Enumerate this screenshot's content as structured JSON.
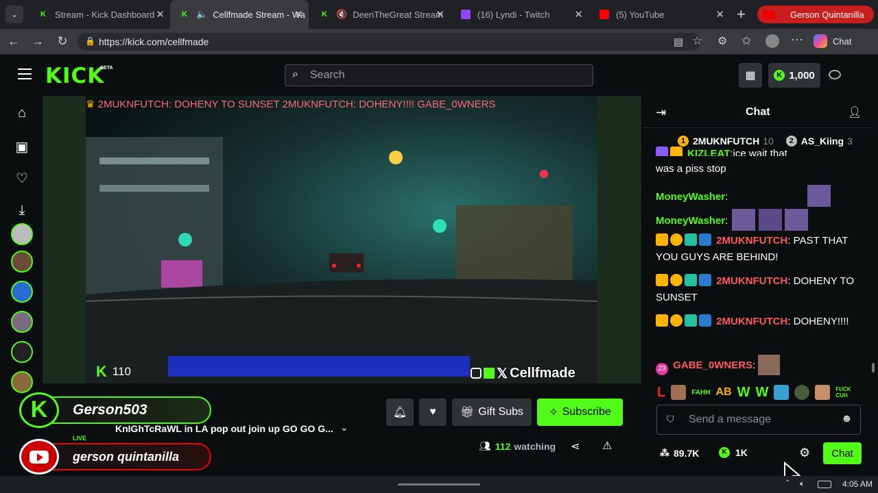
{
  "browser": {
    "tabs": [
      {
        "title": "Stream - Kick Dashboard",
        "favicon_color": "#53fc18"
      },
      {
        "title": "Cellfmade Stream - Wa",
        "favicon_color": "#53fc18"
      },
      {
        "title": "DeenTheGreat Stream",
        "favicon_color": "#53fc18"
      },
      {
        "title": "(16) Lyndi - Twitch",
        "favicon_color": "#9146ff"
      },
      {
        "title": "(5) YouTube",
        "favicon_color": "#ff0000"
      }
    ],
    "profile_name": "Gerson Quintanilla",
    "url": "https://kick.com/cellfmade",
    "copilot_label": "Chat"
  },
  "header": {
    "logo_text": "KICK",
    "beta_label": "BETA",
    "search_placeholder": "Search",
    "balance": "1,000"
  },
  "video": {
    "ticker": "2MUKNFUTCH: DOHENY TO SUNSET   2MUKNFUTCH: DOHENY!!!!   GABE_0WNERS",
    "viewer_count": "110",
    "watermark": "Cellfmade"
  },
  "overlay": {
    "kick_name": "Gerson503",
    "youtube_name": "gerson quintanilla",
    "live_label": "LIVE"
  },
  "stream_info": {
    "title": "KnIGhTcRaWL in LA pop out join up GO GO G...",
    "gift_subs": "Gift Subs",
    "subscribe": "Subscribe",
    "watching_count": "112",
    "watching_label": "watching"
  },
  "chat": {
    "title": "Chat",
    "leaderboard": [
      {
        "name": "2MUKNFUTCH",
        "count": "10",
        "rank": "1"
      },
      {
        "name": "AS_Kiing",
        "count": "3",
        "rank": "2"
      }
    ],
    "partial_top": "was a piss stop",
    "partial_top_name": "KIZLEAT",
    "partial_top_text": ":ice wait that",
    "messages": [
      {
        "user": "MoneyWasher",
        "text": ""
      },
      {
        "user": "MoneyWasher",
        "text": ""
      },
      {
        "user": "2MUKNFUTCH",
        "text": ": PAST THAT YOU GUYS ARE BEHIND!"
      },
      {
        "user": "2MUKNFUTCH",
        "text": ": DOHENY TO SUNSET"
      },
      {
        "user": "2MUKNFUTCH",
        "text": ": DOHENY!!!!"
      },
      {
        "user": "GABE_0WNERS",
        "text": ":",
        "badge": "23"
      }
    ],
    "emote_bar": [
      "L",
      "FAHH",
      "AB",
      "W",
      "W",
      "FUCK CUH"
    ],
    "input_placeholder": "Send a message",
    "stat_points": "89.7K",
    "stat_kicks": "1K",
    "chat_button": "Chat"
  },
  "taskbar": {
    "time": "4:05 AM"
  },
  "colors": {
    "kick_green": "#53fc18",
    "chat_red": "#ff5a5a",
    "youtube_red": "#ff0000"
  }
}
